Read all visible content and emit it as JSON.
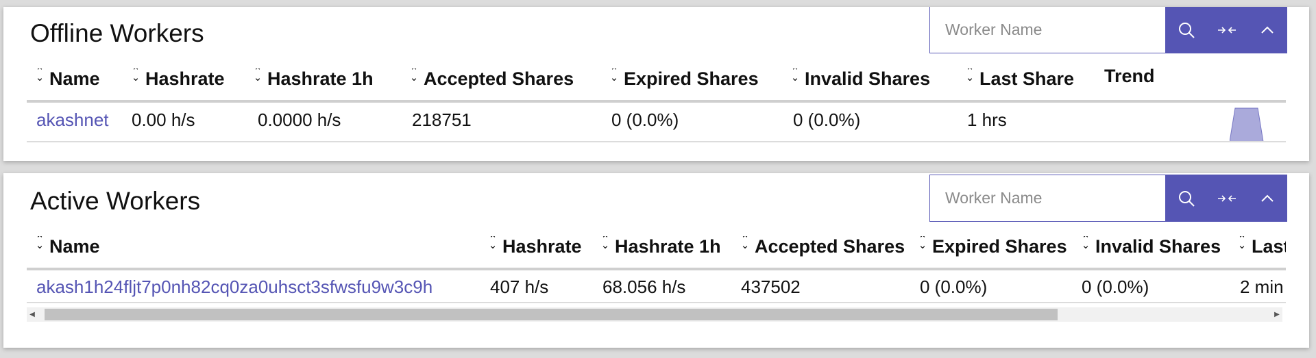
{
  "offline": {
    "title": "Offline Workers",
    "search_placeholder": "Worker Name",
    "columns": [
      "Name",
      "Hashrate",
      "Hashrate 1h",
      "Accepted Shares",
      "Expired Shares",
      "Invalid Shares",
      "Last Share",
      "Trend"
    ],
    "rows": [
      {
        "name": "akashnet",
        "hashrate": "0.00 h/s",
        "hashrate_1h": "0.0000 h/s",
        "accepted": "218751",
        "expired": "0 (0.0%)",
        "invalid": "0 (0.0%)",
        "last_share": "1 hrs"
      }
    ]
  },
  "active": {
    "title": "Active Workers",
    "search_placeholder": "Worker Name",
    "columns": [
      "Name",
      "Hashrate",
      "Hashrate 1h",
      "Accepted Shares",
      "Expired Shares",
      "Invalid Shares",
      "Last Share"
    ],
    "rows": [
      {
        "name": "akash1h24fljt7p0nh82cq0za0uhsct3sfwsfu9w3c9h",
        "hashrate": "407 h/s",
        "hashrate_1h": "68.056 h/s",
        "accepted": "437502",
        "expired": "0 (0.0%)",
        "invalid": "0 (0.0%)",
        "last_share": "2 min"
      }
    ]
  },
  "icons": {
    "search": "search-icon",
    "collapse": "arrows-in-icon",
    "toggle": "chevron-up-icon",
    "sort": "sort-icon"
  },
  "colors": {
    "accent": "#5555b4",
    "trend_fill": "#aaaadb"
  }
}
